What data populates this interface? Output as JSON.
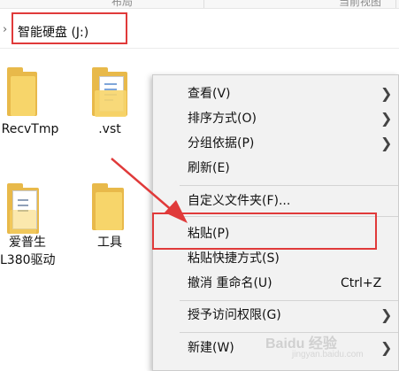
{
  "ribbon": {
    "left_label": "布局",
    "right_label": "当前视图"
  },
  "address": {
    "path": "智能硬盘 (J:)"
  },
  "files": [
    {
      "name": "RecvTmp",
      "type": "folder"
    },
    {
      "name": ".vst",
      "type": "folder"
    },
    {
      "name": "爱普生",
      "name_line2": "L380驱动",
      "type": "folder"
    },
    {
      "name": "工具",
      "type": "folder"
    }
  ],
  "context_menu": {
    "items": [
      {
        "label": "查看(V)",
        "submenu": true
      },
      {
        "label": "排序方式(O)",
        "submenu": true
      },
      {
        "label": "分组依据(P)",
        "submenu": true
      },
      {
        "label": "刷新(E)",
        "submenu": false
      },
      {
        "label": "自定义文件夹(F)...",
        "submenu": false
      },
      {
        "label": "粘贴(P)",
        "submenu": false
      },
      {
        "label": "粘贴快捷方式(S)",
        "submenu": false
      },
      {
        "label": "撤消 重命名(U)",
        "shortcut": "Ctrl+Z",
        "submenu": false
      },
      {
        "label": "授予访问权限(G)",
        "submenu": true
      },
      {
        "label": "新建(W)",
        "submenu": true
      }
    ]
  },
  "icons": {
    "submenu_arrow": "chevron-right-icon",
    "folder": "folder-icon",
    "address_chevron": "chevron-right-icon"
  },
  "colors": {
    "annotation": "#e03a3a",
    "folder_front": "#f7d56a",
    "folder_back": "#e8b94a",
    "menu_background": "#f2f2f2"
  },
  "watermark": {
    "brand": "Baidu 经验",
    "sub": "jingyan.baidu.com"
  }
}
